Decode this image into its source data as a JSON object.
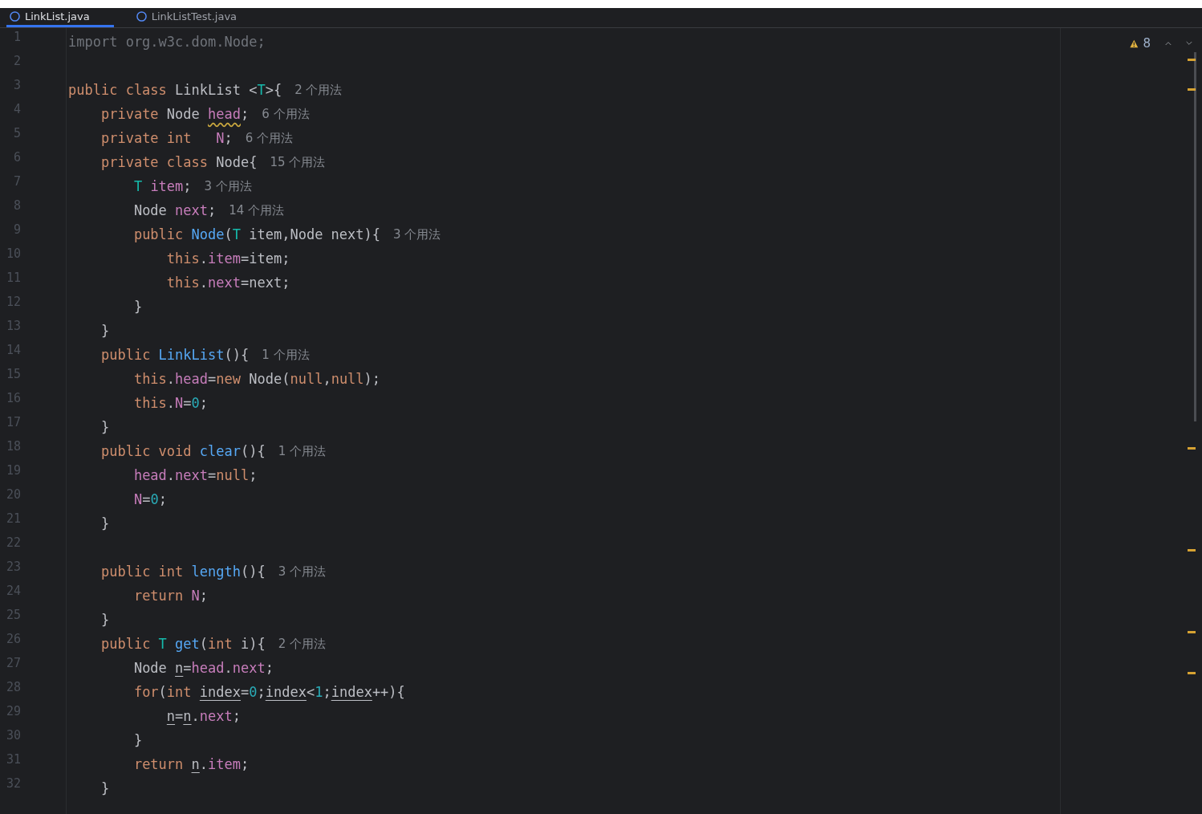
{
  "tabs": [
    {
      "label": "LinkList.java",
      "selected": true
    },
    {
      "label": "LinkListTest.java",
      "selected": false
    }
  ],
  "inspection": {
    "count": "8"
  },
  "lines": [
    {
      "number": "1",
      "tokens": [
        {
          "kind": "unused",
          "text": "import org.w3c.dom.Node;"
        }
      ]
    },
    {
      "number": "2"
    },
    {
      "number": "3",
      "tokens": [
        {
          "kind": "kw",
          "text": "public class "
        },
        {
          "kind": "plain",
          "text": "LinkList <"
        },
        {
          "kind": "tparam",
          "text": "T"
        },
        {
          "kind": "plain",
          "text": ">{"
        },
        {
          "kind": "hint",
          "text": "2 个用法"
        }
      ]
    },
    {
      "number": "4",
      "tokens": [
        {
          "kind": "kw",
          "text": "    private "
        },
        {
          "kind": "plain",
          "text": "Node "
        },
        {
          "kind": "field",
          "text": "head",
          "warning": true
        },
        {
          "kind": "plain",
          "text": ";"
        },
        {
          "kind": "hint",
          "text": "6 个用法"
        }
      ]
    },
    {
      "number": "5",
      "tokens": [
        {
          "kind": "kw",
          "text": "    private int   "
        },
        {
          "kind": "field",
          "text": "N"
        },
        {
          "kind": "plain",
          "text": ";"
        },
        {
          "kind": "hint",
          "text": "6 个用法"
        }
      ]
    },
    {
      "number": "6",
      "tokens": [
        {
          "kind": "kw",
          "text": "    private class "
        },
        {
          "kind": "plain",
          "text": "Node{"
        },
        {
          "kind": "hint",
          "text": "15 个用法"
        }
      ]
    },
    {
      "number": "7",
      "tokens": [
        {
          "kind": "tparam",
          "text": "        T "
        },
        {
          "kind": "field",
          "text": "item"
        },
        {
          "kind": "plain",
          "text": ";"
        },
        {
          "kind": "hint",
          "text": "3 个用法"
        }
      ]
    },
    {
      "number": "8",
      "tokens": [
        {
          "kind": "plain",
          "text": "        Node "
        },
        {
          "kind": "field",
          "text": "next"
        },
        {
          "kind": "plain",
          "text": ";"
        },
        {
          "kind": "hint",
          "text": "14 个用法"
        }
      ]
    },
    {
      "number": "9",
      "tokens": [
        {
          "kind": "kw",
          "text": "        public "
        },
        {
          "kind": "fn",
          "text": "Node"
        },
        {
          "kind": "plain",
          "text": "("
        },
        {
          "kind": "tparam",
          "text": "T"
        },
        {
          "kind": "plain",
          "text": " item,Node next){"
        },
        {
          "kind": "hint",
          "text": "3 个用法"
        }
      ]
    },
    {
      "number": "10",
      "tokens": [
        {
          "kind": "kw",
          "text": "            this"
        },
        {
          "kind": "plain",
          "text": "."
        },
        {
          "kind": "field",
          "text": "item"
        },
        {
          "kind": "plain",
          "text": "=item;"
        }
      ]
    },
    {
      "number": "11",
      "tokens": [
        {
          "kind": "kw",
          "text": "            this"
        },
        {
          "kind": "plain",
          "text": "."
        },
        {
          "kind": "field",
          "text": "next"
        },
        {
          "kind": "plain",
          "text": "=next;"
        }
      ]
    },
    {
      "number": "12",
      "tokens": [
        {
          "kind": "plain",
          "text": "        }"
        }
      ]
    },
    {
      "number": "13",
      "tokens": [
        {
          "kind": "plain",
          "text": "    }"
        }
      ]
    },
    {
      "number": "14",
      "tokens": [
        {
          "kind": "kw",
          "text": "    public "
        },
        {
          "kind": "fn",
          "text": "LinkList"
        },
        {
          "kind": "plain",
          "text": "(){"
        },
        {
          "kind": "hint",
          "text": "1 个用法"
        }
      ]
    },
    {
      "number": "15",
      "tokens": [
        {
          "kind": "kw",
          "text": "        this"
        },
        {
          "kind": "plain",
          "text": "."
        },
        {
          "kind": "field",
          "text": "head"
        },
        {
          "kind": "plain",
          "text": "="
        },
        {
          "kind": "kw",
          "text": "new "
        },
        {
          "kind": "plain",
          "text": "Node("
        },
        {
          "kind": "kw",
          "text": "null"
        },
        {
          "kind": "plain",
          "text": ","
        },
        {
          "kind": "kw",
          "text": "null"
        },
        {
          "kind": "plain",
          "text": ");"
        }
      ]
    },
    {
      "number": "16",
      "tokens": [
        {
          "kind": "kw",
          "text": "        this"
        },
        {
          "kind": "plain",
          "text": "."
        },
        {
          "kind": "field",
          "text": "N"
        },
        {
          "kind": "plain",
          "text": "="
        },
        {
          "kind": "num",
          "text": "0"
        },
        {
          "kind": "plain",
          "text": ";"
        }
      ]
    },
    {
      "number": "17",
      "tokens": [
        {
          "kind": "plain",
          "text": "    }"
        }
      ]
    },
    {
      "number": "18",
      "tokens": [
        {
          "kind": "kw",
          "text": "    public void "
        },
        {
          "kind": "fn",
          "text": "clear"
        },
        {
          "kind": "plain",
          "text": "(){"
        },
        {
          "kind": "hint",
          "text": "1 个用法"
        }
      ]
    },
    {
      "number": "19",
      "tokens": [
        {
          "kind": "field",
          "text": "        head"
        },
        {
          "kind": "plain",
          "text": "."
        },
        {
          "kind": "field",
          "text": "next"
        },
        {
          "kind": "plain",
          "text": "="
        },
        {
          "kind": "kw",
          "text": "null"
        },
        {
          "kind": "plain",
          "text": ";"
        }
      ]
    },
    {
      "number": "20",
      "tokens": [
        {
          "kind": "field",
          "text": "        N"
        },
        {
          "kind": "plain",
          "text": "="
        },
        {
          "kind": "num",
          "text": "0"
        },
        {
          "kind": "plain",
          "text": ";"
        }
      ]
    },
    {
      "number": "21",
      "tokens": [
        {
          "kind": "plain",
          "text": "    }"
        }
      ]
    },
    {
      "number": "22"
    },
    {
      "number": "23",
      "tokens": [
        {
          "kind": "kw",
          "text": "    public int "
        },
        {
          "kind": "fn",
          "text": "length"
        },
        {
          "kind": "plain",
          "text": "(){"
        },
        {
          "kind": "hint",
          "text": "3 个用法"
        }
      ]
    },
    {
      "number": "24",
      "tokens": [
        {
          "kind": "kw",
          "text": "        return "
        },
        {
          "kind": "field",
          "text": "N"
        },
        {
          "kind": "plain",
          "text": ";"
        }
      ]
    },
    {
      "number": "25",
      "tokens": [
        {
          "kind": "plain",
          "text": "    }"
        }
      ]
    },
    {
      "number": "26",
      "tokens": [
        {
          "kind": "kw",
          "text": "    public "
        },
        {
          "kind": "tparam",
          "text": "T "
        },
        {
          "kind": "fn",
          "text": "get"
        },
        {
          "kind": "plain",
          "text": "("
        },
        {
          "kind": "kw",
          "text": "int "
        },
        {
          "kind": "plain",
          "text": "i){"
        },
        {
          "kind": "hint",
          "text": "2 个用法"
        }
      ]
    },
    {
      "number": "27",
      "tokens": [
        {
          "kind": "plain",
          "text": "        Node "
        },
        {
          "kind": "plain",
          "text": "n",
          "underlined": true
        },
        {
          "kind": "plain",
          "text": "="
        },
        {
          "kind": "field",
          "text": "head"
        },
        {
          "kind": "plain",
          "text": "."
        },
        {
          "kind": "field",
          "text": "next"
        },
        {
          "kind": "plain",
          "text": ";"
        }
      ]
    },
    {
      "number": "28",
      "tokens": [
        {
          "kind": "kw",
          "text": "        for"
        },
        {
          "kind": "plain",
          "text": "("
        },
        {
          "kind": "kw",
          "text": "int "
        },
        {
          "kind": "plain",
          "text": "index",
          "underlined": true
        },
        {
          "kind": "plain",
          "text": "="
        },
        {
          "kind": "num",
          "text": "0"
        },
        {
          "kind": "plain",
          "text": ";"
        },
        {
          "kind": "plain",
          "text": "index",
          "underlined": true
        },
        {
          "kind": "plain",
          "text": "<"
        },
        {
          "kind": "num",
          "text": "1"
        },
        {
          "kind": "plain",
          "text": ";"
        },
        {
          "kind": "plain",
          "text": "index",
          "underlined": true
        },
        {
          "kind": "plain",
          "text": "++){"
        }
      ]
    },
    {
      "number": "29",
      "tokens": [
        {
          "kind": "plain",
          "text": "            n",
          "underlined": true
        },
        {
          "kind": "plain",
          "text": "="
        },
        {
          "kind": "plain",
          "text": "n",
          "underlined": true
        },
        {
          "kind": "plain",
          "text": "."
        },
        {
          "kind": "field",
          "text": "next"
        },
        {
          "kind": "plain",
          "text": ";"
        }
      ]
    },
    {
      "number": "30",
      "tokens": [
        {
          "kind": "plain",
          "text": "        }"
        }
      ]
    },
    {
      "number": "31",
      "tokens": [
        {
          "kind": "kw",
          "text": "        return "
        },
        {
          "kind": "plain",
          "text": "n",
          "underlined": true
        },
        {
          "kind": "plain",
          "text": "."
        },
        {
          "kind": "field",
          "text": "item"
        },
        {
          "kind": "plain",
          "text": ";"
        }
      ]
    },
    {
      "number": "32",
      "tokens": [
        {
          "kind": "plain",
          "text": "    }"
        }
      ]
    }
  ]
}
